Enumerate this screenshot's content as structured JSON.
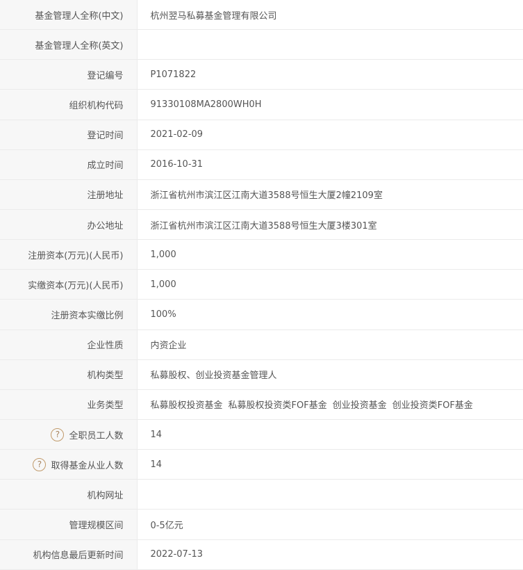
{
  "rows": [
    {
      "label": "基金管理人全称(中文)",
      "value": "杭州翌马私募基金管理有限公司"
    },
    {
      "label": "基金管理人全称(英文)",
      "value": ""
    },
    {
      "label": "登记编号",
      "value": "P1071822"
    },
    {
      "label": "组织机构代码",
      "value": "91330108MA2800WH0H"
    },
    {
      "label": "登记时间",
      "value": "2021-02-09"
    },
    {
      "label": "成立时间",
      "value": "2016-10-31"
    },
    {
      "label": "注册地址",
      "value": "浙江省杭州市滨江区江南大道3588号恒生大厦2幢2109室"
    },
    {
      "label": "办公地址",
      "value": "浙江省杭州市滨江区江南大道3588号恒生大厦3楼301室"
    },
    {
      "label": "注册资本(万元)(人民币)",
      "value": "1,000"
    },
    {
      "label": "实缴资本(万元)(人民币)",
      "value": "1,000"
    },
    {
      "label": "注册资本实缴比例",
      "value": "100%"
    },
    {
      "label": "企业性质",
      "value": "内资企业"
    },
    {
      "label": "机构类型",
      "value": "私募股权、创业投资基金管理人"
    },
    {
      "label": "业务类型",
      "values": [
        "私募股权投资基金",
        "私募股权投资类FOF基金",
        "创业投资基金",
        "创业投资类FOF基金"
      ]
    },
    {
      "label": "全职员工人数",
      "value": "14",
      "help_icon": "?"
    },
    {
      "label": "取得基金从业人数",
      "value": "14",
      "help_icon": "?"
    },
    {
      "label": "机构网址",
      "value": ""
    },
    {
      "label": "管理规模区间",
      "value": "0-5亿元"
    },
    {
      "label": "机构信息最后更新时间",
      "value": "2022-07-13"
    }
  ]
}
